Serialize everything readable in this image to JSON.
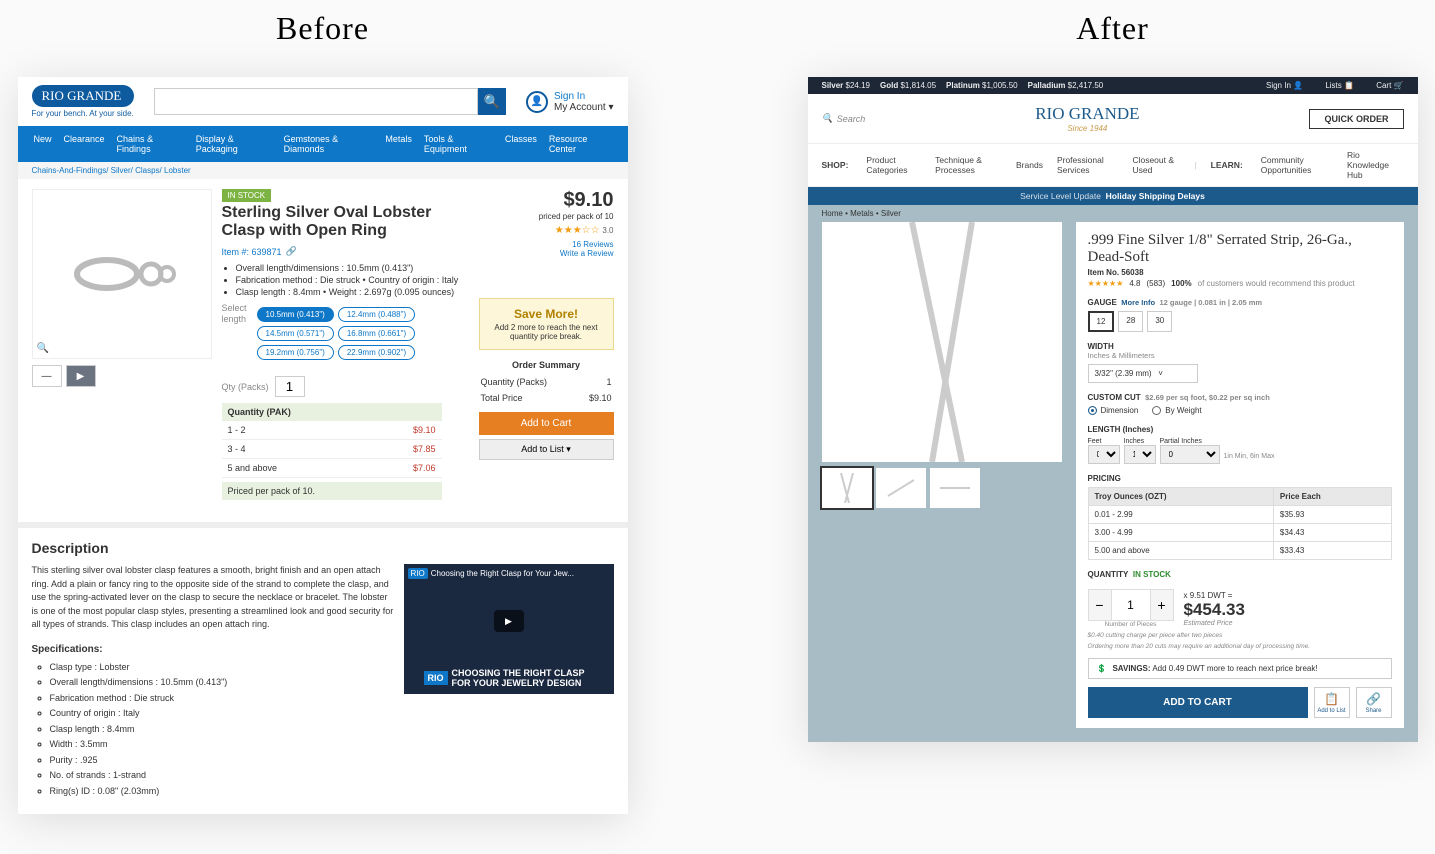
{
  "labels": {
    "before": "Before",
    "after": "After"
  },
  "before": {
    "logo": "RIO GRANDE",
    "tagline": "For your bench. At your side.",
    "signin": "Sign In",
    "myaccount": "My Account ▾",
    "nav": [
      "New",
      "Clearance",
      "Chains & Findings",
      "Display & Packaging",
      "Gemstones & Diamonds",
      "Metals",
      "Tools & Equipment",
      "Classes",
      "Resource Center"
    ],
    "breadcrumb": "Chains-And-Findings/ Silver/ Clasps/ Lobster",
    "stock": "IN STOCK",
    "title": "Sterling Silver Oval Lobster Clasp with Open Ring",
    "item_num": "Item #: 639871",
    "bullets": [
      "Overall length/dimensions : 10.5mm (0.413\")",
      "Fabrication method : Die struck   •   Country of origin : Italy",
      "Clasp length : 8.4mm   •   Weight : 2.697g (0.095 ounces)"
    ],
    "select_len": "Select length",
    "chips": [
      "10.5mm (0.413\")",
      "12.4mm (0.488\")",
      "14.5mm (0.571\")",
      "16.8mm (0.661\")",
      "19.2mm (0.756\")",
      "22.9mm (0.902\")"
    ],
    "qty_label": "Qty (Packs)",
    "qty_val": "1",
    "tier_header": [
      "Quantity (PAK)",
      ""
    ],
    "tiers": [
      [
        "1 - 2",
        "$9.10"
      ],
      [
        "3 - 4",
        "$7.85"
      ],
      [
        "5 and above",
        "$7.06"
      ]
    ],
    "priced_per": "Priced per pack of 10.",
    "price": "$9.10",
    "price_per": "priced per pack of 10",
    "star_val": "3.0",
    "reviews": "16 Reviews",
    "write": "Write a Review",
    "save_title": "Save More!",
    "save_txt": "Add 2 more to reach the next quantity price break.",
    "order_sum": "Order Summary",
    "ord_rows": [
      [
        "Quantity (Packs)",
        "1"
      ],
      [
        "Total Price",
        "$9.10"
      ]
    ],
    "add_cart": "Add to Cart",
    "add_list": "Add to List ▾",
    "desc_h": "Description",
    "desc_txt": "This sterling silver oval lobster clasp features a smooth, bright finish and an open attach ring. Add a plain or fancy ring to the opposite side of the strand to complete the clasp, and use the spring-activated lever on the clasp to secure the necklace or bracelet. The lobster is one of the most popular clasp styles, presenting a streamlined look and good security for all types of strands. This clasp includes an open attach ring.",
    "video_top": "Choosing the Right Clasp for Your Jew...",
    "video_caption": "CHOOSING THE RIGHT CLASP FOR YOUR JEWELRY DESIGN",
    "specs_h": "Specifications:",
    "specs": [
      "Clasp type : Lobster",
      "Overall length/dimensions : 10.5mm (0.413\")",
      "Fabrication method : Die struck",
      "Country of origin : Italy",
      "Clasp length : 8.4mm",
      "Width : 3.5mm",
      "Purity : .925",
      "No. of strands : 1-strand",
      "Ring(s) ID : 0.08\" (2.03mm)"
    ]
  },
  "after": {
    "metals": [
      [
        "Silver",
        "$24.19"
      ],
      [
        "Gold",
        "$1,814.05"
      ],
      [
        "Platinum",
        "$1,005.50"
      ],
      [
        "Palladium",
        "$2,417.50"
      ]
    ],
    "signin": "Sign In",
    "lists": "Lists",
    "cart": "Cart",
    "search_ph": "Search",
    "logo": "RIO GRANDE",
    "since": "Since 1944",
    "quick": "QUICK ORDER",
    "nav_shop": "SHOP:",
    "nav_items": [
      "Product Categories",
      "Technique & Processes",
      "Brands",
      "Professional Services",
      "Closeout & Used"
    ],
    "nav_learn": "LEARN:",
    "nav_learn_items": [
      "Community Opportunities",
      "Rio Knowledge Hub"
    ],
    "alert_a": "Service Level Update",
    "alert_b": "Holiday Shipping Delays",
    "crumb": "Home   •   Metals   •   Silver",
    "title": ".999 Fine Silver 1/8\" Serrated Strip, 26-Ga., Dead-Soft",
    "itemno": "Item No. 56038",
    "rating": "4.8",
    "rcount": "(583)",
    "recpct": "100%",
    "rectxt": "of customers would recommend this product",
    "gauge_label": "GAUGE",
    "more_info": "More Info",
    "gauge_note": "12 gauge | 0.081 in | 2.05 mm",
    "gauges": [
      "12",
      "28",
      "30"
    ],
    "width_label": "WIDTH",
    "width_sub": "Inches & Millimeters",
    "width_val": "3/32\" (2.39 mm)",
    "cut_label": "CUSTOM CUT",
    "cut_note": "$2.69 per sq foot, $0.22 per sq inch",
    "radio_a": "Dimension",
    "radio_b": "By Weight",
    "len_label": "LENGTH (Inches)",
    "len_feet": "Feet",
    "len_in": "Inches",
    "len_part": "Partial Inches",
    "feet_v": "0",
    "in_v": "1",
    "part_v": "0",
    "minmax": "1in Min, 6in Max",
    "pricing": "PRICING",
    "pth": [
      "Troy Ounces (OZT)",
      "Price Each"
    ],
    "ptiers": [
      [
        "0.01 - 2.99",
        "$35.93"
      ],
      [
        "3.00 - 4.99",
        "$34.43"
      ],
      [
        "5.00 and above",
        "$33.43"
      ]
    ],
    "qty_label": "QUANTITY",
    "instock": "IN STOCK",
    "qty_v": "1",
    "pieces": "Number of Pieces",
    "est_line": "x 9.51 DWT =",
    "est_price": "$454.33",
    "est_lbl": "Estimated Price",
    "fine1": "$0.40 cutting charge per piece after two pieces",
    "fine2": "Ordering more than 20 cuts may require an additional day of processing time.",
    "savings_b": "SAVINGS:",
    "savings_t": "Add 0.49 DWT more to reach next price break!",
    "add_cart": "ADD TO CART",
    "add_list": "Add to List",
    "share": "Share"
  }
}
